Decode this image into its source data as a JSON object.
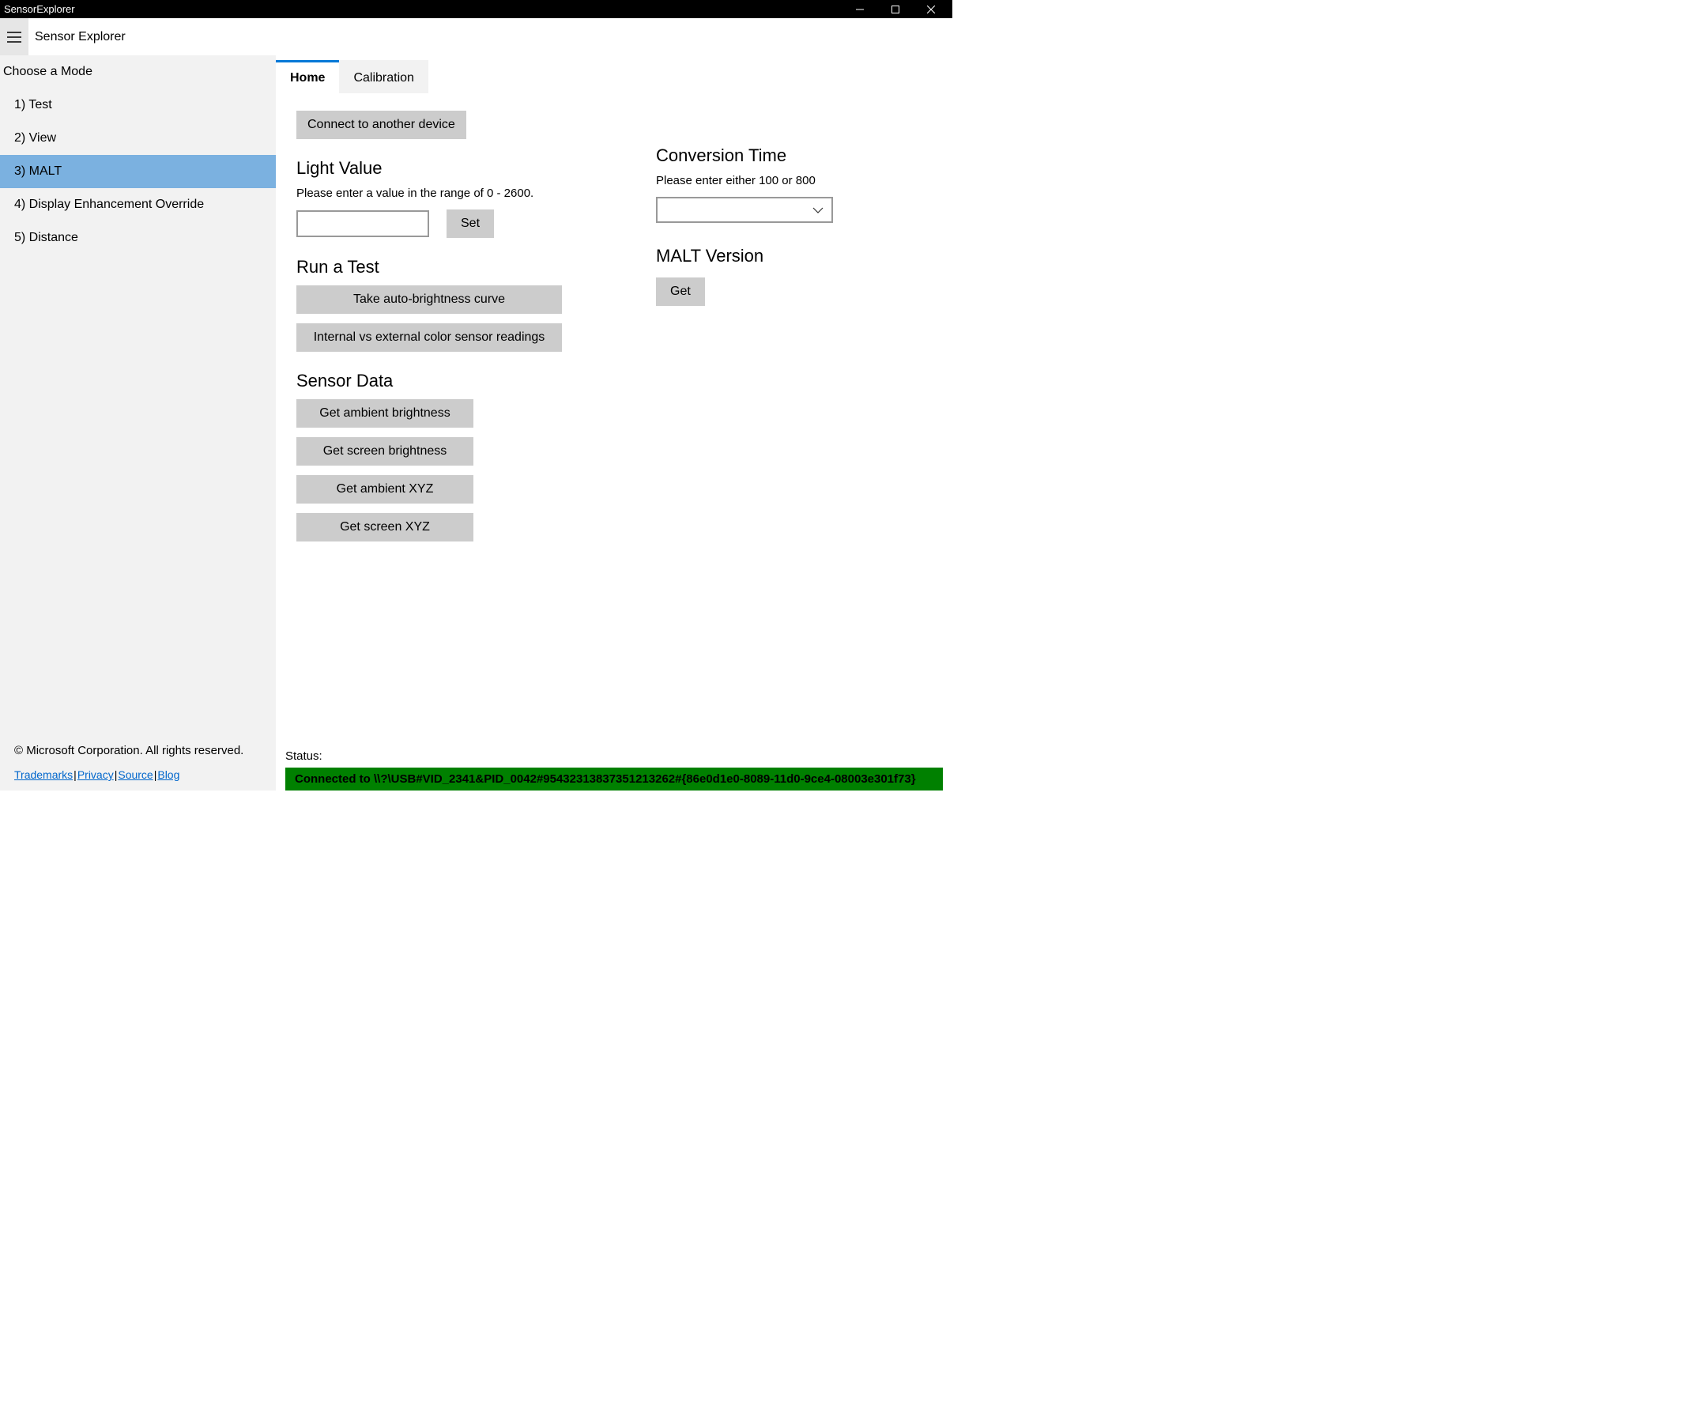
{
  "titlebar": {
    "title": "SensorExplorer"
  },
  "header": {
    "app_name": "Sensor Explorer"
  },
  "sidebar": {
    "title": "Choose a Mode",
    "items": [
      {
        "label": "1) Test",
        "selected": false
      },
      {
        "label": "2) View",
        "selected": false
      },
      {
        "label": "3) MALT",
        "selected": true
      },
      {
        "label": "4) Display Enhancement Override",
        "selected": false
      },
      {
        "label": "5) Distance",
        "selected": false
      }
    ],
    "copyright": "© Microsoft Corporation. All rights reserved.",
    "links": [
      {
        "label": "Trademarks"
      },
      {
        "label": "Privacy"
      },
      {
        "label": "Source"
      },
      {
        "label": "Blog"
      }
    ]
  },
  "tabs": [
    {
      "label": "Home",
      "active": true
    },
    {
      "label": "Calibration",
      "active": false
    }
  ],
  "buttons": {
    "connect": "Connect to another device",
    "set": "Set",
    "get": "Get",
    "auto_brightness": "Take auto-brightness curve",
    "color_sensor": "Internal vs external color sensor readings",
    "ambient_brightness": "Get ambient brightness",
    "screen_brightness": "Get screen brightness",
    "ambient_xyz": "Get ambient XYZ",
    "screen_xyz": "Get screen XYZ"
  },
  "sections": {
    "light_value": {
      "title": "Light Value",
      "hint": "Please enter a value in the range of 0 - 2600."
    },
    "conversion_time": {
      "title": "Conversion Time",
      "hint": "Please enter either 100 or 800"
    },
    "run_test": {
      "title": "Run a Test"
    },
    "malt_version": {
      "title": "MALT Version"
    },
    "sensor_data": {
      "title": "Sensor Data"
    }
  },
  "inputs": {
    "light_value": "",
    "conversion_time": ""
  },
  "status": {
    "label": "Status:",
    "text": "Connected to \\\\?\\USB#VID_2341&PID_0042#95432313837351213262#{86e0d1e0-8089-11d0-9ce4-08003e301f73}"
  }
}
